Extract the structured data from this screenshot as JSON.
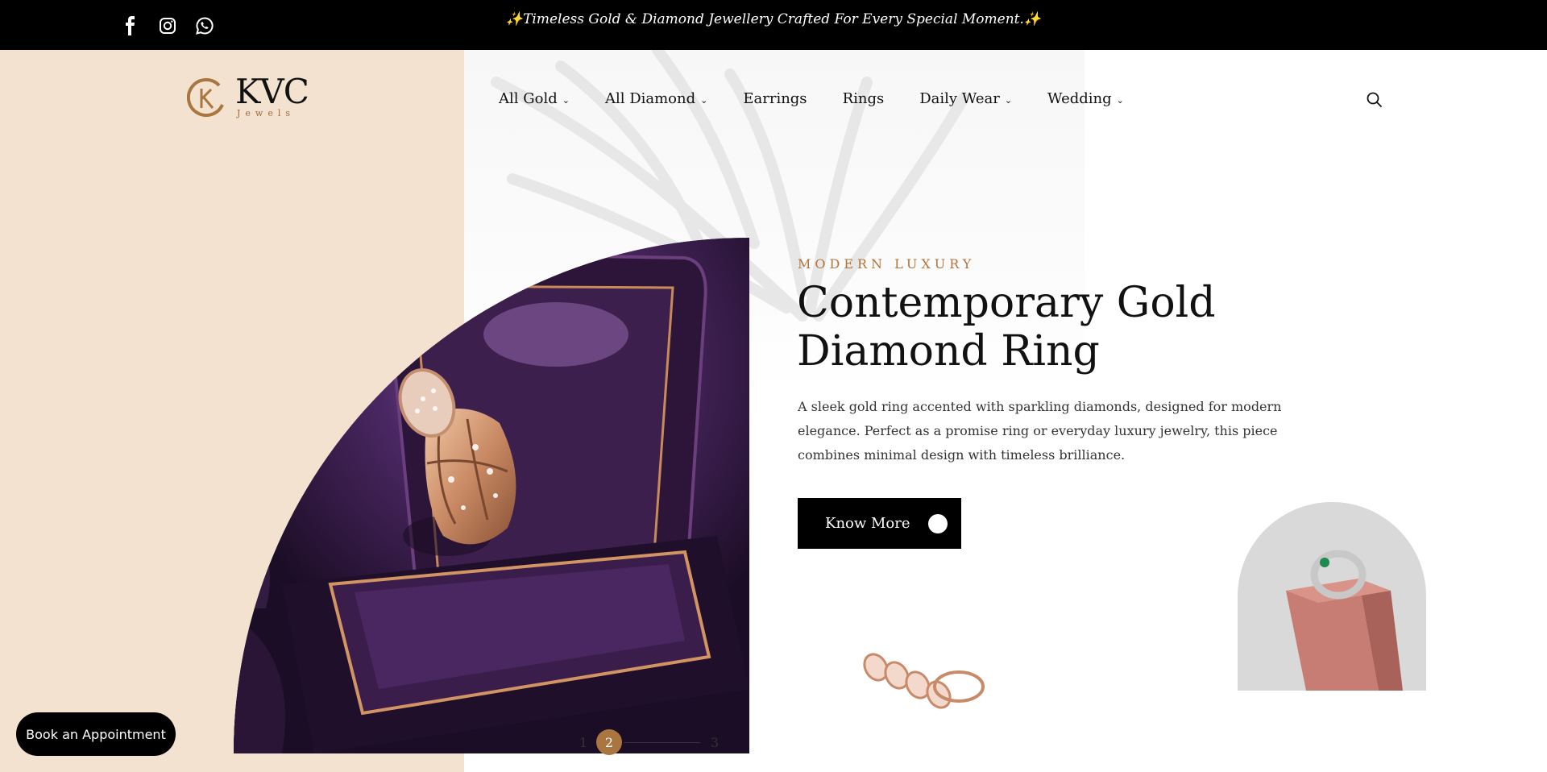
{
  "topbar": {
    "announcement": "✨Timeless Gold & Diamond Jewellery Crafted For Every Special Moment.✨",
    "social": [
      {
        "icon": "facebook-icon"
      },
      {
        "icon": "instagram-icon"
      },
      {
        "icon": "whatsapp-icon"
      }
    ]
  },
  "brand": {
    "name": "KVC",
    "tagline": "Jewels",
    "accent": "#a9763f"
  },
  "nav": {
    "items": [
      {
        "label": "All Gold",
        "has_dropdown": true
      },
      {
        "label": "All Diamond",
        "has_dropdown": true
      },
      {
        "label": "Earrings",
        "has_dropdown": false
      },
      {
        "label": "Rings",
        "has_dropdown": false
      },
      {
        "label": "Daily Wear",
        "has_dropdown": true
      },
      {
        "label": "Wedding",
        "has_dropdown": true
      }
    ],
    "caret": "⌄",
    "search_icon": "search-icon"
  },
  "hero": {
    "eyebrow": "MODERN LUXURY",
    "title": "Contemporary Gold Diamond Ring",
    "description": "A sleek gold ring accented with sparkling diamonds, designed for modern elegance. Perfect as a promise ring or everyday luxury jewelry, this piece combines minimal design with timeless brilliance.",
    "cta_label": "Know More",
    "slides": [
      "1",
      "2",
      "3"
    ],
    "active_slide": "2"
  },
  "floating": {
    "book_label": "Book an Appointment"
  },
  "colors": {
    "beige": "#f2e2cf",
    "gold": "#b3733a",
    "black": "#000000"
  }
}
